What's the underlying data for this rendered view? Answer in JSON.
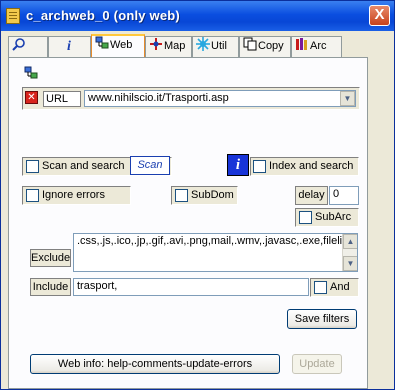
{
  "window": {
    "title": "c_archweb_0 (only web)",
    "close_symbol": "X"
  },
  "tabs": [
    {
      "name": "search",
      "label": "",
      "icon": "magnifier-icon"
    },
    {
      "name": "info",
      "label": "",
      "icon": "info-icon"
    },
    {
      "name": "web",
      "label": "Web",
      "icon": "network-icon"
    },
    {
      "name": "map",
      "label": "Map",
      "icon": "map-icon"
    },
    {
      "name": "util",
      "label": "Util",
      "icon": "util-icon"
    },
    {
      "name": "copy",
      "label": "Copy",
      "icon": "copy-icon"
    },
    {
      "name": "arc",
      "label": "Arc",
      "icon": "books-icon"
    }
  ],
  "url": {
    "label": "URL",
    "value": "www.nihilscio.it/Trasporti.asp"
  },
  "scan": {
    "label": "Scan and search",
    "button": "Scan"
  },
  "index": {
    "label": "Index and search",
    "icon_letter": "i"
  },
  "ignore_errors": {
    "label": "Ignore errors"
  },
  "subdom": {
    "label": "SubDom"
  },
  "delay": {
    "label": "delay",
    "value": "0"
  },
  "subarc": {
    "label": "SubArc"
  },
  "exclude": {
    "label": "Exclude",
    "value": ".css,.js,.ico,.jp,.gif,.avi,.png,mail,.wmv,.javasc,.exe,filelist.xml,.lit,.djvu,"
  },
  "include": {
    "label": "Include",
    "value": "trasport,"
  },
  "and": {
    "label": "And"
  },
  "save_filters": "Save filters",
  "web_info": "Web info: help-comments-update-errors",
  "update": "Update",
  "colors": {
    "title_bar": "#0a4ee0",
    "face": "#ece9d8",
    "close_button": "#c8421c",
    "info_button": "#1834d8"
  }
}
